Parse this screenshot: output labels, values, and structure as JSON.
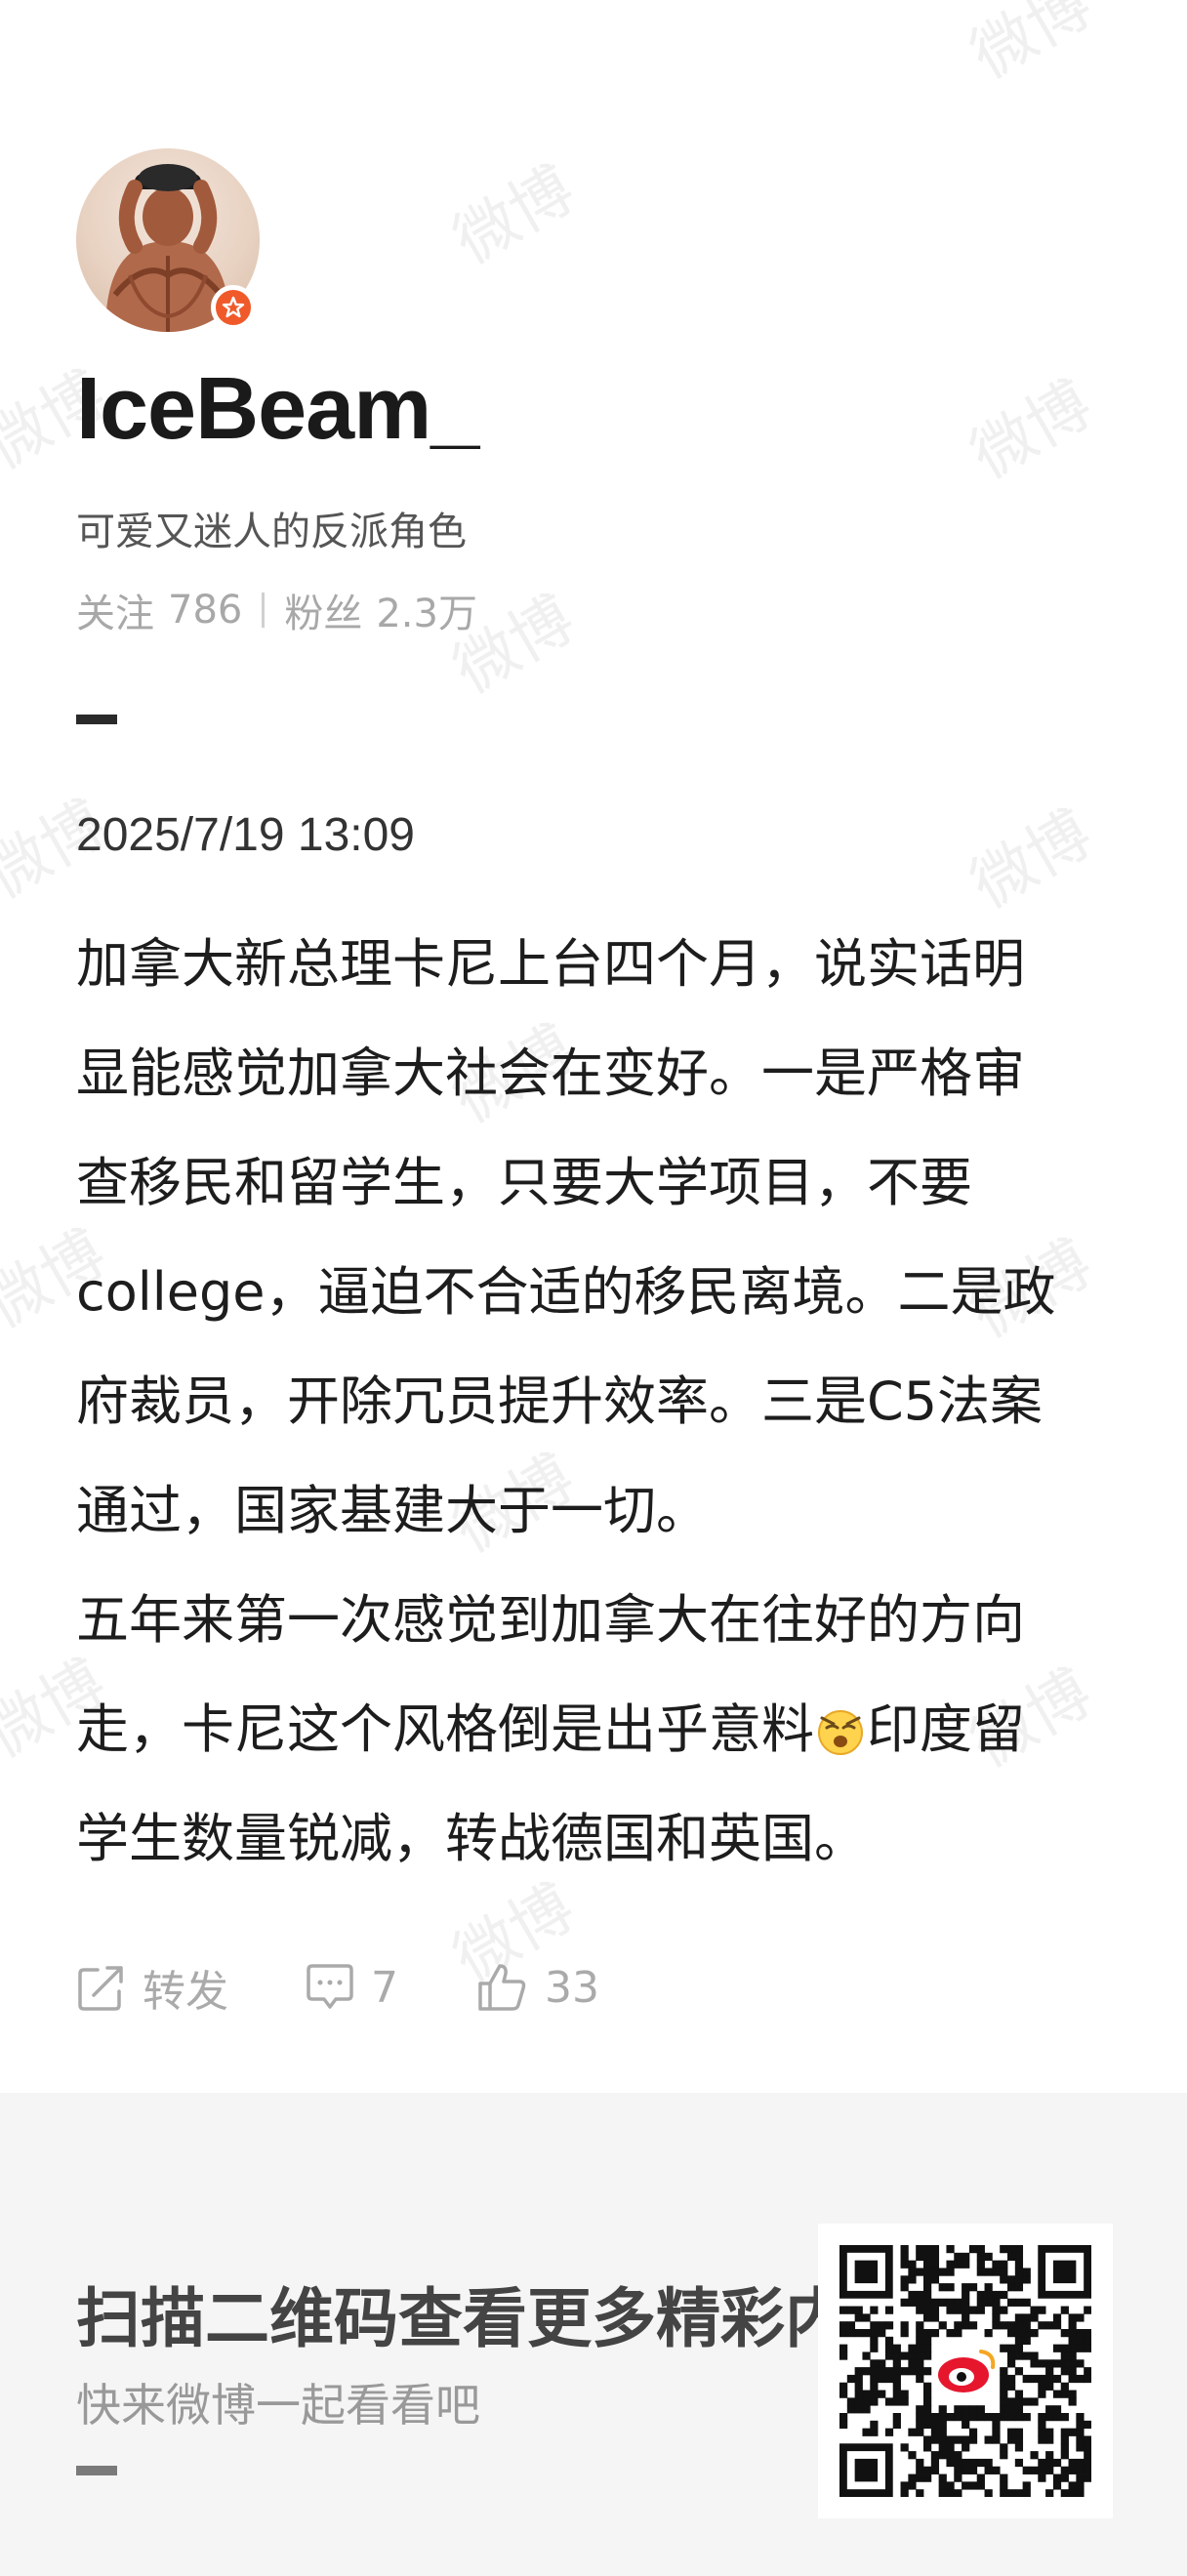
{
  "watermark": "微博",
  "profile": {
    "username": "IceBeam_",
    "bio": "可爱又迷人的反派角色",
    "following_label": "关注",
    "following_count": "786",
    "followers_label": "粉丝",
    "followers_count": "2.3万"
  },
  "post": {
    "timestamp": "2025/7/19 13:09",
    "lines": [
      "加拿大新总理卡尼上台四个月，说实话明",
      "显能感觉加拿大社会在变好。一是严格审",
      "查移民和留学生，只要大学项目，不要",
      "college，逼迫不合适的移民离境。二是政",
      "府裁员，开除冗员提升效率。三是C5法案",
      "通过，国家基建大于一切。",
      "五年来第一次感觉到加拿大在往好的方向",
      "走，卡尼这个风格倒是出乎意料",
      "印度留",
      "学生数量锐减，转战德国和英国。"
    ]
  },
  "actions": {
    "repost_label": "转发",
    "comment_count": "7",
    "like_count": "33"
  },
  "footer": {
    "title": "扫描二维码查看更多精彩内容",
    "subtitle": "快来微博一起看看吧"
  },
  "colors": {
    "badge": "#f05a2a",
    "qr_logo": "#e6162d"
  }
}
